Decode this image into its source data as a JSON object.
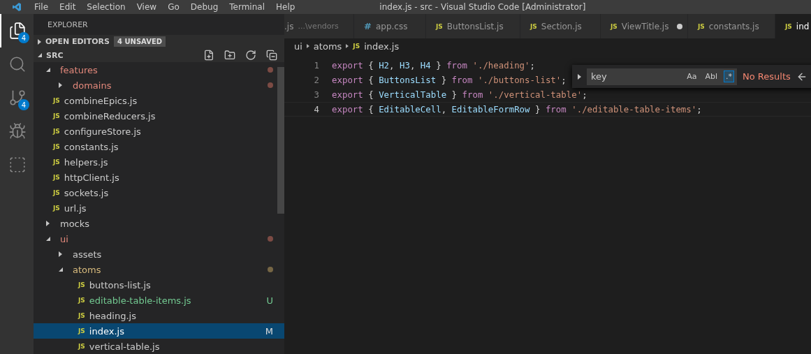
{
  "menu": [
    "File",
    "Edit",
    "Selection",
    "View",
    "Go",
    "Debug",
    "Terminal",
    "Help"
  ],
  "window": {
    "title": "index.js - src - Visual Studio Code [Administrator]"
  },
  "activity_bar": [
    {
      "kind": "files",
      "badge": "4",
      "selected": true
    },
    {
      "kind": "search",
      "selected": false
    },
    {
      "kind": "scm",
      "badge": "4",
      "selected": false
    },
    {
      "kind": "debug",
      "selected": false
    },
    {
      "kind": "extensions",
      "selected": false
    }
  ],
  "sidebar": {
    "title": "EXPLORER",
    "open_editors": {
      "label": "OPEN EDITORS",
      "badge": "4 UNSAVED",
      "expanded": false
    },
    "root": {
      "label": "SRC",
      "expanded": true
    },
    "tree": [
      {
        "label": "features",
        "kind": "folder",
        "expanded": true,
        "color": "#e2887b",
        "dot": true,
        "children": [
          {
            "label": "domains",
            "kind": "folder",
            "expanded": false,
            "color": "#e2887b",
            "dot": true
          }
        ]
      },
      {
        "label": "combineEpics.js",
        "kind": "file",
        "icon": "JS",
        "color": "#cccccc"
      },
      {
        "label": "combineReducers.js",
        "kind": "file",
        "icon": "JS",
        "color": "#cccccc"
      },
      {
        "label": "configureStore.js",
        "kind": "file",
        "icon": "JS",
        "color": "#cccccc"
      },
      {
        "label": "constants.js",
        "kind": "file",
        "icon": "JS",
        "color": "#cccccc"
      },
      {
        "label": "helpers.js",
        "kind": "file",
        "icon": "JS",
        "color": "#cccccc"
      },
      {
        "label": "httpClient.js",
        "kind": "file",
        "icon": "JS",
        "color": "#cccccc"
      },
      {
        "label": "sockets.js",
        "kind": "file",
        "icon": "JS",
        "color": "#cccccc"
      },
      {
        "label": "url.js",
        "kind": "file",
        "icon": "JS",
        "color": "#cccccc"
      },
      {
        "label": "mocks",
        "kind": "folder",
        "expanded": false,
        "color": "#cccccc"
      },
      {
        "label": "ui",
        "kind": "folder",
        "expanded": true,
        "color": "#e2887b",
        "dot": true,
        "children": [
          {
            "label": "assets",
            "kind": "folder",
            "expanded": false,
            "color": "#cccccc"
          },
          {
            "label": "atoms",
            "kind": "folder",
            "expanded": true,
            "color": "#d7ba7d",
            "dot": true,
            "children": [
              {
                "label": "buttons-list.js",
                "kind": "file",
                "icon": "JS",
                "color": "#cccccc"
              },
              {
                "label": "editable-table-items.js",
                "kind": "file",
                "icon": "JS",
                "color": "#73c991",
                "badge": "U"
              },
              {
                "label": "heading.js",
                "kind": "file",
                "icon": "JS",
                "color": "#cccccc"
              },
              {
                "label": "index.js",
                "kind": "file",
                "icon": "JS",
                "color": "#ffffff",
                "badge": "M",
                "selected": true
              },
              {
                "label": "vertical-table.js",
                "kind": "file",
                "icon": "JS",
                "color": "#cccccc"
              }
            ]
          }
        ]
      }
    ]
  },
  "tabs": [
    {
      "label": ".js",
      "description": "...\\vendors",
      "selected": false,
      "dirty": false
    },
    {
      "label": "app.css",
      "icon": "#",
      "kind": "css",
      "selected": false,
      "dirty": false
    },
    {
      "label": "ButtonsList.js",
      "icon": "JS",
      "kind": "js",
      "selected": false,
      "dirty": false
    },
    {
      "label": "Section.js",
      "icon": "JS",
      "kind": "js",
      "selected": false,
      "dirty": false
    },
    {
      "label": "ViewTitle.js",
      "icon": "JS",
      "kind": "js",
      "selected": false,
      "dirty": true
    },
    {
      "label": "constants.js",
      "icon": "JS",
      "kind": "js",
      "selected": false,
      "dirty": false
    },
    {
      "label": "ind",
      "icon": "JS",
      "kind": "js",
      "selected": true,
      "dirty": false
    }
  ],
  "breadcrumbs": [
    {
      "label": "ui"
    },
    {
      "label": "atoms"
    },
    {
      "label": "index.js",
      "icon": "JS"
    }
  ],
  "code": [
    {
      "number": "1",
      "tokens": [
        {
          "kind": "keyword",
          "text": "export"
        },
        {
          "kind": "punct",
          "text": " { "
        },
        {
          "kind": "ident",
          "text": "H2"
        },
        {
          "kind": "punct",
          "text": ", "
        },
        {
          "kind": "ident",
          "text": "H3"
        },
        {
          "kind": "punct",
          "text": ", "
        },
        {
          "kind": "ident",
          "text": "H4"
        },
        {
          "kind": "punct",
          "text": " } "
        },
        {
          "kind": "keyword",
          "text": "from "
        },
        {
          "kind": "string",
          "text": "'./heading'"
        },
        {
          "kind": "punct",
          "text": ";"
        }
      ]
    },
    {
      "number": "2",
      "tokens": [
        {
          "kind": "keyword",
          "text": "export"
        },
        {
          "kind": "punct",
          "text": " { "
        },
        {
          "kind": "ident",
          "text": "ButtonsList"
        },
        {
          "kind": "punct",
          "text": " } "
        },
        {
          "kind": "keyword",
          "text": "from "
        },
        {
          "kind": "string",
          "text": "'./buttons-list'"
        },
        {
          "kind": "punct",
          "text": ";"
        }
      ]
    },
    {
      "number": "3",
      "tokens": [
        {
          "kind": "keyword",
          "text": "export"
        },
        {
          "kind": "punct",
          "text": " { "
        },
        {
          "kind": "ident",
          "text": "VerticalTable"
        },
        {
          "kind": "punct",
          "text": " } "
        },
        {
          "kind": "keyword",
          "text": "from "
        },
        {
          "kind": "string",
          "text": "'./vertical-table'"
        },
        {
          "kind": "punct",
          "text": ";"
        }
      ]
    },
    {
      "number": "4",
      "current": true,
      "tokens": [
        {
          "kind": "keyword",
          "text": "export"
        },
        {
          "kind": "punct",
          "text": " { "
        },
        {
          "kind": "ident",
          "text": "EditableCell"
        },
        {
          "kind": "punct",
          "text": ", "
        },
        {
          "kind": "ident",
          "text": "EditableFormRow"
        },
        {
          "kind": "punct",
          "text": " } "
        },
        {
          "kind": "keyword",
          "text": "from "
        },
        {
          "kind": "string",
          "text": "'./editable-table-items'"
        },
        {
          "kind": "punct",
          "text": ";"
        }
      ]
    }
  ],
  "find_widget": {
    "value": "key",
    "options": [
      {
        "label": "Aa",
        "selected": false
      },
      {
        "label": "Abl",
        "selected": false
      },
      {
        "label": ".*",
        "selected": true
      }
    ],
    "result": "No Results"
  }
}
